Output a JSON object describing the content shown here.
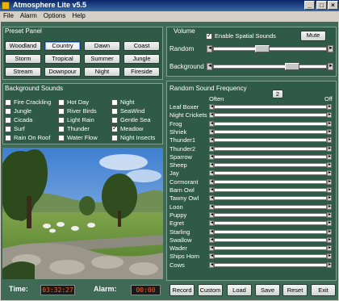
{
  "window": {
    "title": "Atmosphere Lite v5.5"
  },
  "menu": [
    "File",
    "Alarm",
    "Options",
    "Help"
  ],
  "preset_panel": {
    "title": "Preset Panel",
    "presets": [
      [
        "Woodland",
        "Country",
        "Dawn",
        "Coast"
      ],
      [
        "Storm",
        "Tropical",
        "Summer",
        "Jungle"
      ],
      [
        "Stream",
        "Downpour",
        "Night",
        "Fireside"
      ]
    ],
    "selected": "Country"
  },
  "volume": {
    "title": "Volume",
    "spatial_label": "Enable Spatial Sounds",
    "spatial_checked": true,
    "mute_label": "Mute",
    "random_label": "Random",
    "random_level": 0.42,
    "background_label": "Background",
    "background_level": 0.72
  },
  "background_sounds": {
    "title": "Background Sounds",
    "columns": [
      [
        {
          "label": "Fire Crackling",
          "checked": false
        },
        {
          "label": "Jungle",
          "checked": false
        },
        {
          "label": "Cicada",
          "checked": false
        },
        {
          "label": "Surf",
          "checked": false
        },
        {
          "label": "Rain On Roof",
          "checked": false
        }
      ],
      [
        {
          "label": "Hot Day",
          "checked": false
        },
        {
          "label": "River Birds",
          "checked": false
        },
        {
          "label": "Light Rain",
          "checked": false
        },
        {
          "label": "Thunder",
          "checked": false
        },
        {
          "label": "Water Flow",
          "checked": false
        }
      ],
      [
        {
          "label": "Night",
          "checked": false
        },
        {
          "label": "SeaWind",
          "checked": false
        },
        {
          "label": "Gentle Sea",
          "checked": false
        },
        {
          "label": "Meadow",
          "checked": true
        },
        {
          "label": "Night Insects",
          "checked": false
        }
      ]
    ]
  },
  "random_freq": {
    "title": "Random Sound Frequency",
    "counter": "2",
    "often_label": "Often",
    "off_label": "Off",
    "sounds": [
      "Leaf Boxer",
      "Night Crickets",
      "Frog",
      "Shriek",
      "Thunder1",
      "Thunder2",
      "Sparrow",
      "Sheep",
      "Jay",
      "Cormorant",
      "Barn Owl",
      "Tawny Owl",
      "Loon",
      "Puppy",
      "Egret",
      "Starling",
      "Swallow",
      "Wader",
      "Ships Horn",
      "Cows"
    ]
  },
  "clock": {
    "time_label": "Time:",
    "time_value": "03:32:27",
    "alarm_label": "Alarm:",
    "alarm_value": "00:00"
  },
  "bottom_buttons": [
    "Record",
    "Custom",
    "Load",
    "Save",
    "Reset",
    "Exit"
  ],
  "colors": {
    "frame": "#3e6a56",
    "panel": "#2f5a48",
    "lcd_text": "#ff5a2a"
  }
}
